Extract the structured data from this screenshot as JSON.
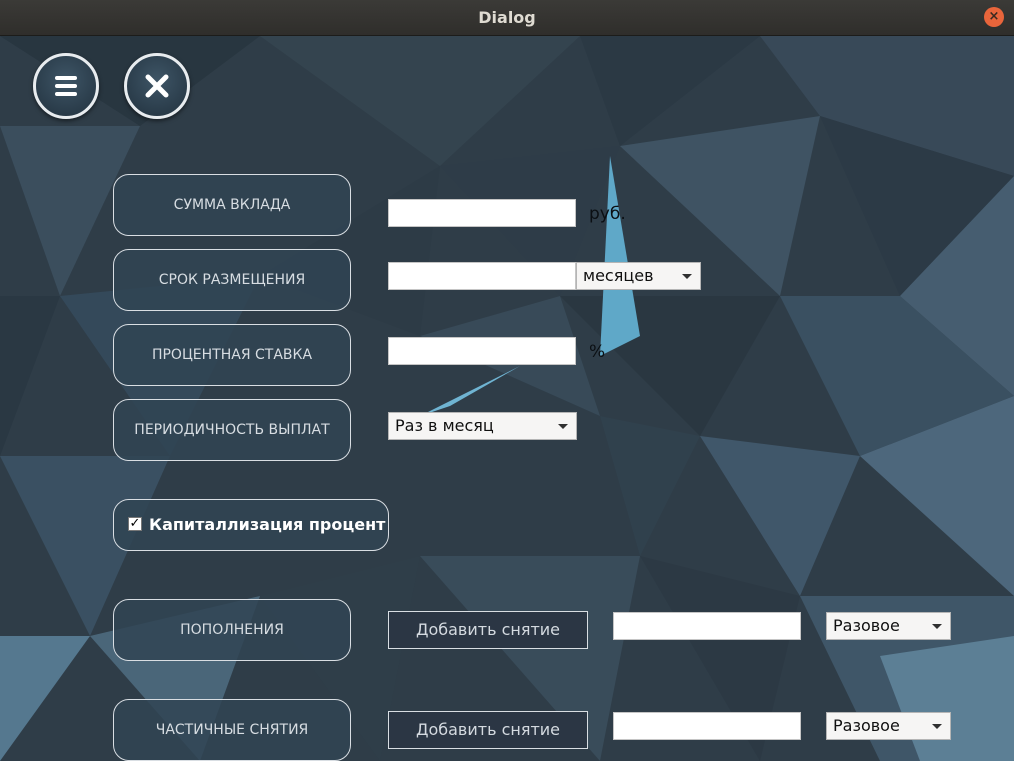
{
  "window": {
    "title": "Dialog"
  },
  "toolbar": {
    "menu_icon": "menu-icon",
    "close_icon": "close-icon"
  },
  "deposit": {
    "label": "СУММА ВКЛАДА",
    "value": "",
    "unit": "руб."
  },
  "term": {
    "label": "СРОК РАЗМЕЩЕНИЯ",
    "value": "",
    "unit_selected": "месяцев"
  },
  "rate": {
    "label": "ПРОЦЕНТНАЯ СТАВКА",
    "value": "",
    "unit": "%"
  },
  "payout": {
    "label": "ПЕРИОДИЧНОСТЬ ВЫПЛАТ",
    "selected": "Раз в месяц"
  },
  "capitalization": {
    "label": "Капиталлизация процент",
    "checked": true,
    "check_mark": "✓"
  },
  "deposits": {
    "label": "ПОПОЛНЕНИЯ",
    "button": "Добавить снятие",
    "amount": "",
    "type_selected": "Разовое"
  },
  "withdrawals": {
    "label": "ЧАСТИЧНЫЕ СНЯТИЯ",
    "button": "Добавить снятие",
    "amount": "",
    "type_selected": "Разовое"
  },
  "colors": {
    "background": "#2e3a45",
    "accent": "#5fa8c8",
    "label_bg": "#304454"
  }
}
